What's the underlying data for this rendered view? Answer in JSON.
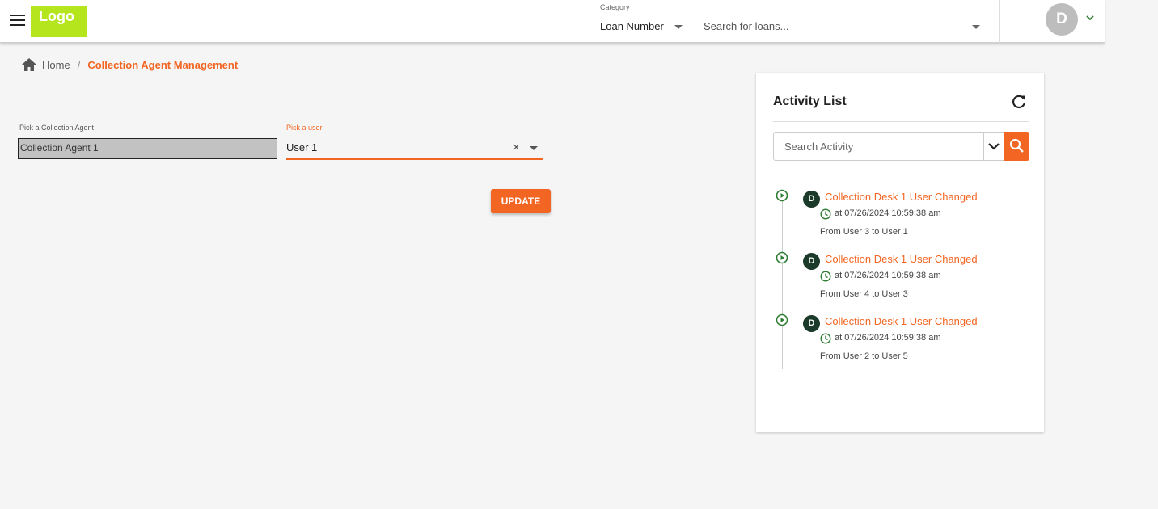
{
  "header": {
    "logo": "Logo",
    "category_label": "Category",
    "category_value": "Loan Number",
    "search_placeholder": "Search for loans...",
    "avatar_initial": "D"
  },
  "breadcrumb": {
    "home": "Home",
    "separator": "/",
    "current": "Collection Agent Management"
  },
  "form": {
    "agent_label": "Pick a Collection Agent",
    "agent_value": "Collection Agent 1",
    "user_label": "Pick a user",
    "user_value": "User 1",
    "clear": "×",
    "update_label": "UPDATE"
  },
  "activity": {
    "title": "Activity List",
    "search_placeholder": "Search Activity",
    "items": [
      {
        "avatar": "D",
        "title": "Collection Desk 1 User Changed",
        "time": "at 07/26/2024 10:59:38 am",
        "desc": "From User 3 to User 1"
      },
      {
        "avatar": "D",
        "title": "Collection Desk 1 User Changed",
        "time": "at 07/26/2024 10:59:38 am",
        "desc": "From User 4 to User 3"
      },
      {
        "avatar": "D",
        "title": "Collection Desk 1 User Changed",
        "time": "at 07/26/2024 10:59:38 am",
        "desc": "From User 2 to User 5"
      }
    ]
  },
  "colors": {
    "accent": "#f26522",
    "logo_bg": "#b5e61d",
    "timeline_green": "#2e7d32",
    "avatar_dark": "#1b3a2a"
  },
  "icons": [
    "menu-icon",
    "chevron-down-icon",
    "home-icon",
    "refresh-icon",
    "search-icon",
    "play-circle-icon",
    "clock-icon",
    "close-icon"
  ]
}
